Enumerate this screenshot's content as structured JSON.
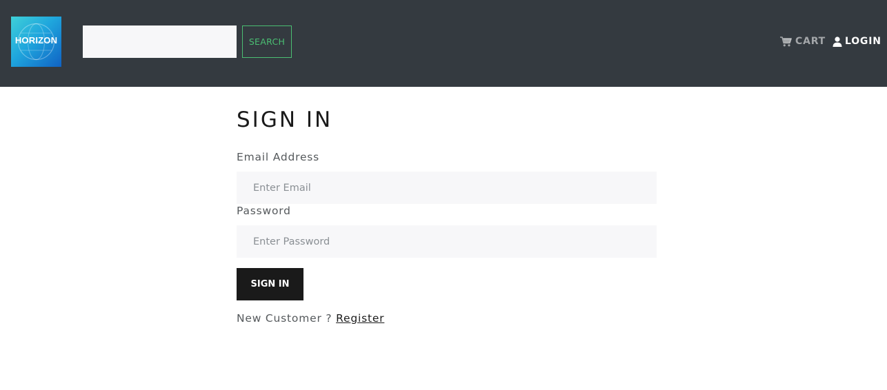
{
  "header": {
    "logo_text": "HORIZON",
    "search": {
      "value": "",
      "placeholder": "",
      "button_label": "SEARCH"
    },
    "nav": {
      "cart_label": "CART",
      "cart_icon": "shopping-cart-icon",
      "login_label": "LOGIN",
      "login_icon": "user-icon"
    }
  },
  "form": {
    "title": "SIGN IN",
    "email": {
      "label": "Email Address",
      "placeholder": "Enter Email",
      "value": ""
    },
    "password": {
      "label": "Password",
      "placeholder": "Enter Password",
      "value": ""
    },
    "submit_label": "SIGN IN",
    "register_prompt": "New Customer ? ",
    "register_link": "Register"
  },
  "colors": {
    "navbar_bg": "#343a40",
    "accent_green": "#4bbf73",
    "button_dark": "#1a1a1a",
    "input_bg": "#f7f7f9"
  }
}
